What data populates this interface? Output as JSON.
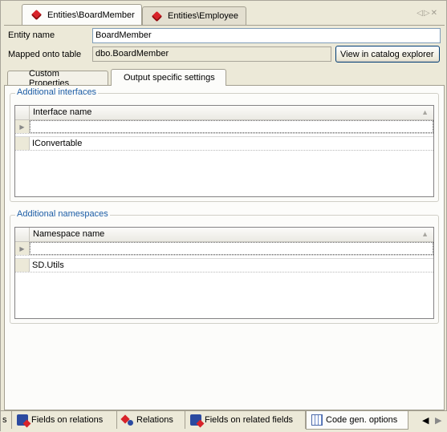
{
  "doc_tabs": [
    {
      "label": "Entities\\BoardMember",
      "active": true
    },
    {
      "label": "Entities\\Employee",
      "active": false
    }
  ],
  "entity": {
    "name_label": "Entity name",
    "name_value": "BoardMember",
    "mapped_label": "Mapped onto table",
    "mapped_value": "dbo.BoardMember",
    "catalog_button": "View in catalog explorer"
  },
  "inner_tabs": [
    {
      "label": "Custom Properties",
      "active": false
    },
    {
      "label": "Output specific settings",
      "active": true
    }
  ],
  "interfaces": {
    "group_title": "Additional interfaces",
    "column": "Interface name",
    "rows": [
      "IConvertable"
    ]
  },
  "namespaces": {
    "group_title": "Additional namespaces",
    "column": "Namespace name",
    "rows": [
      "SD.Utils"
    ]
  },
  "bottom_tabs": [
    {
      "label": "s",
      "icon": "",
      "active": false
    },
    {
      "label": "Fields on relations",
      "icon": "fields-on-relations-icon",
      "active": false
    },
    {
      "label": "Relations",
      "icon": "relations-icon",
      "active": false
    },
    {
      "label": "Fields on related fields",
      "icon": "fields-on-related-fields-icon",
      "active": false
    },
    {
      "label": "Code gen. options",
      "icon": "code-gen-options-icon",
      "active": true
    }
  ],
  "colors": {
    "accent": "#1c5da6",
    "entity_gem": "#d8232a"
  }
}
